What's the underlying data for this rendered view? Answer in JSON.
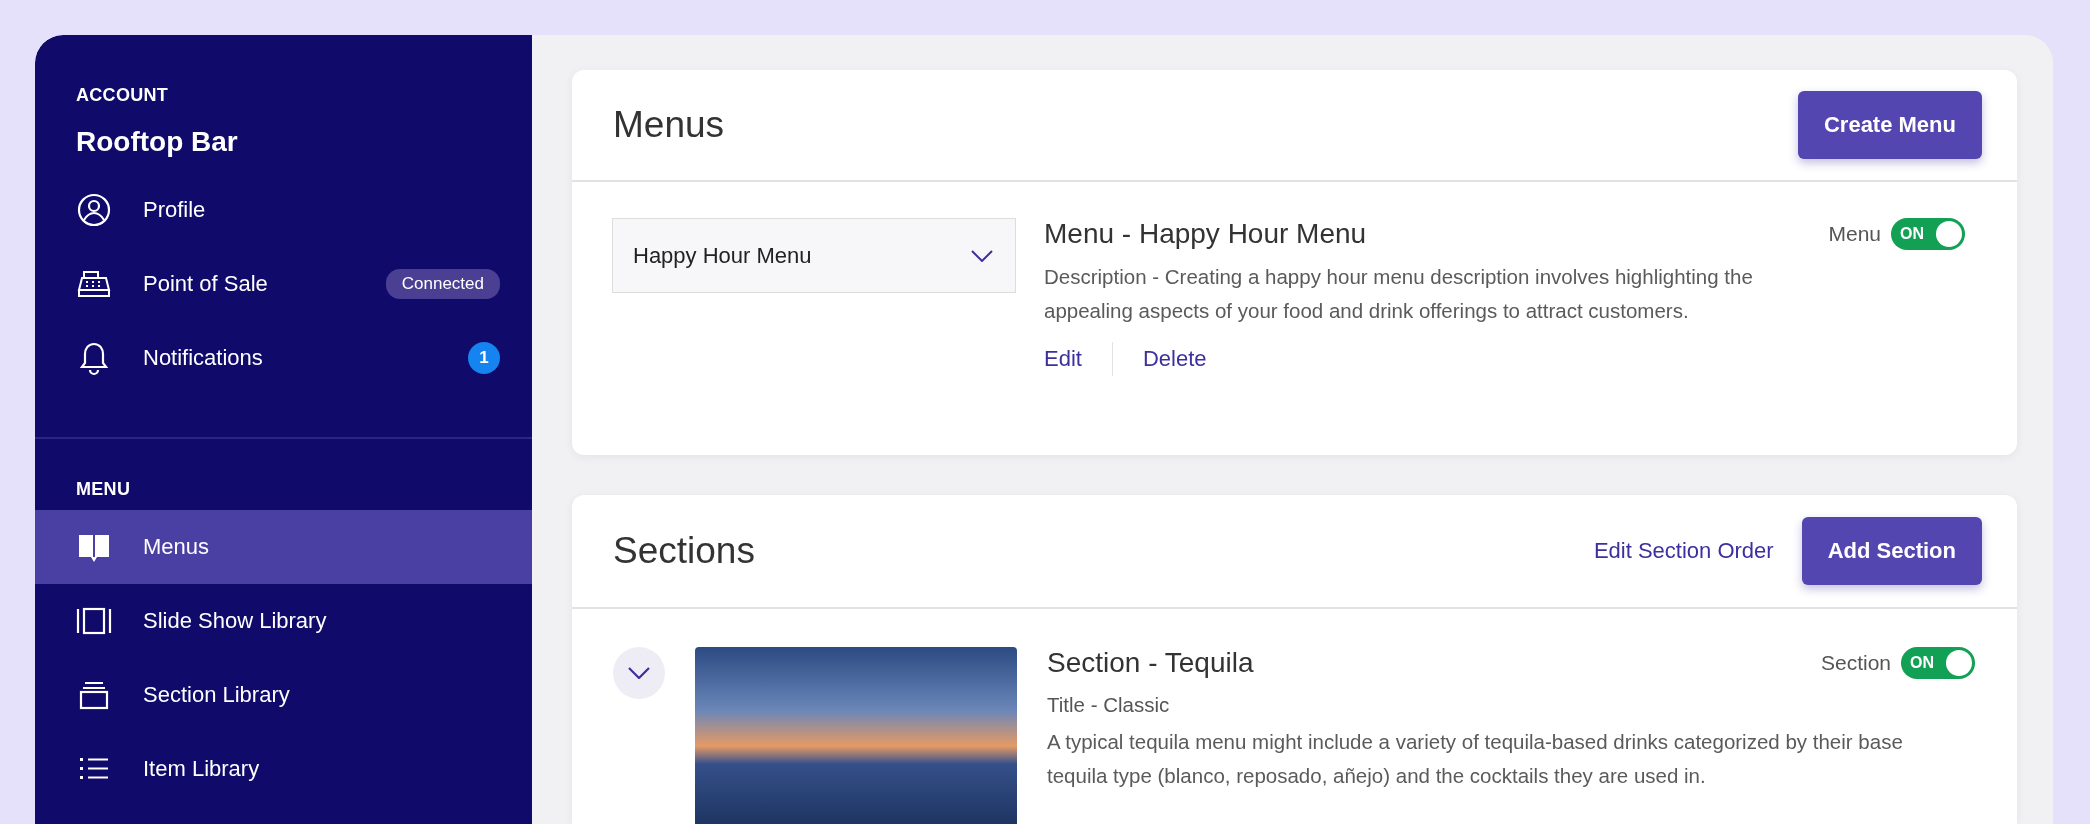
{
  "sidebar": {
    "account_heading": "ACCOUNT",
    "account_name": "Rooftop Bar",
    "account_items": [
      {
        "label": "Profile",
        "selected": false
      },
      {
        "label": "Point of Sale",
        "selected": false,
        "badge": {
          "kind": "pill",
          "text": "Connected"
        }
      },
      {
        "label": "Notifications",
        "selected": false,
        "badge": {
          "kind": "count",
          "text": "1"
        }
      }
    ],
    "menu_heading": "MENU",
    "menu_items": [
      {
        "label": "Menus",
        "selected": true
      },
      {
        "label": "Slide Show Library",
        "selected": false
      },
      {
        "label": "Section Library",
        "selected": false
      },
      {
        "label": "Item Library",
        "selected": false
      }
    ]
  },
  "menus_card": {
    "title": "Menus",
    "create_button": "Create Menu",
    "dropdown": {
      "value": "Happy Hour Menu"
    },
    "menu": {
      "title": "Menu - Happy Hour Menu",
      "description": "Description - Creating a happy hour menu description involves highlighting the appealing aspects of your food and drink offerings to attract customers.",
      "actions": [
        "Edit",
        "Delete"
      ],
      "toggle": {
        "label": "Menu",
        "on": true,
        "text": "ON"
      }
    }
  },
  "sections_card": {
    "title": "Sections",
    "order_link": "Edit Section Order",
    "add_button": "Add Section",
    "sections": [
      {
        "expanded": false,
        "title": "Section - Tequila",
        "subtitle": "Title - Classic",
        "description": "A typical tequila menu might include a variety of tequila-based drinks categorized by their base tequila type (blanco, reposado, añejo) and the cocktails they are used in.",
        "toggle": {
          "label": "Section",
          "on": true,
          "text": "ON"
        }
      }
    ]
  }
}
